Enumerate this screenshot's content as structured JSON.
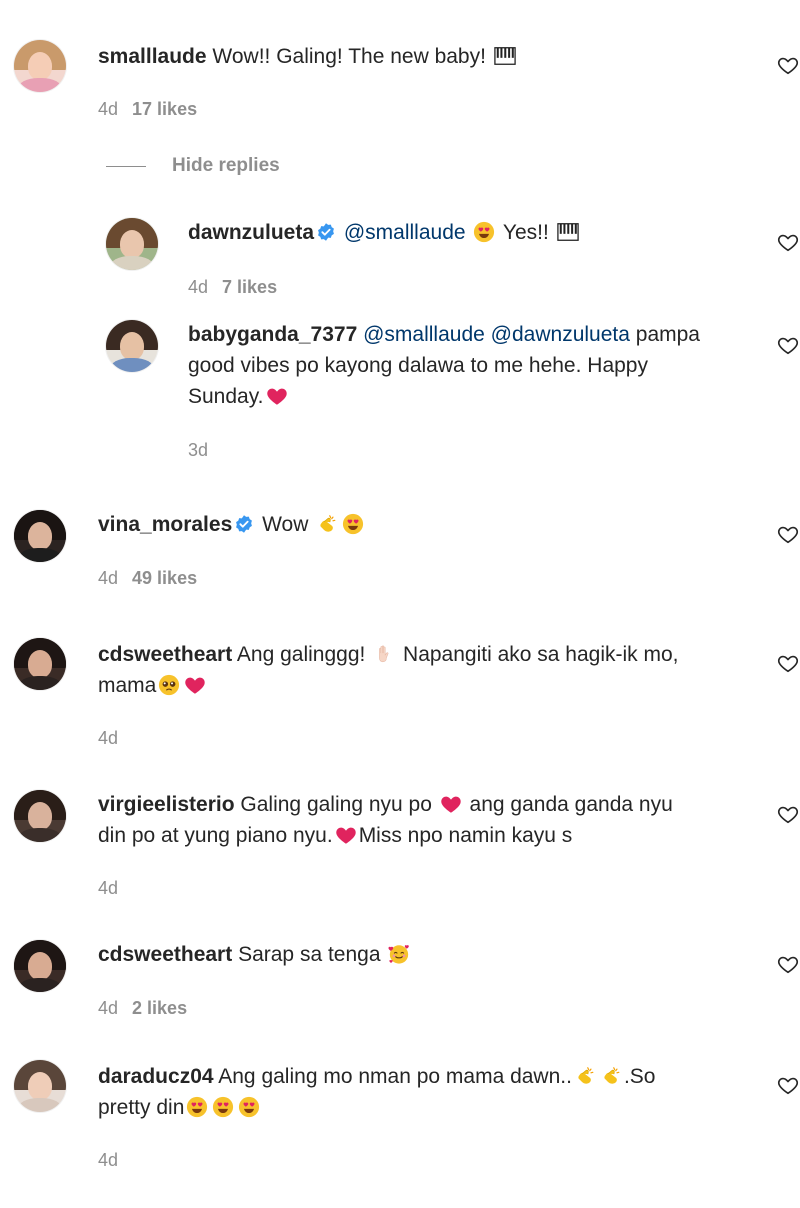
{
  "comments": [
    {
      "id": "c1",
      "username": "smalllaude",
      "verified": false,
      "text_parts": [
        "Wow!! Galing! The new baby! "
      ],
      "emojis_after": [
        "piano"
      ],
      "time": "4d",
      "likes": "17 likes"
    },
    {
      "id": "r1",
      "username": "dawnzulueta",
      "verified": true,
      "mention": "@smalllaude",
      "text_parts": [
        "Yes!! "
      ],
      "emojis_before": [
        "heart-eyes"
      ],
      "emojis_after": [
        "piano"
      ],
      "time": "4d",
      "likes": "7 likes"
    },
    {
      "id": "r2",
      "username": "babyganda_7377",
      "verified": false,
      "mentions": [
        "@smalllaude",
        "@dawnzulueta"
      ],
      "line1_rest": "pampa",
      "line2": "good vibes po kayong dalawa to me hehe. Happy",
      "line3": "Sunday.",
      "emojis_after": [
        "red-heart"
      ],
      "time": "3d",
      "likes": ""
    },
    {
      "id": "c2",
      "username": "vina_morales",
      "verified": true,
      "text_parts": [
        "Wow "
      ],
      "emojis_after": [
        "clapping",
        "heart-eyes"
      ],
      "time": "4d",
      "likes": "49 likes"
    },
    {
      "id": "c3",
      "username": "cdsweetheart",
      "verified": false,
      "line1": "Ang galinggg! ",
      "line1b": " Napangiti ako sa hagik-ik mo,",
      "line2": "mama",
      "time": "4d",
      "likes": ""
    },
    {
      "id": "c4",
      "username": "virgieelisterio",
      "verified": false,
      "line1": "Galing galing nyu po ",
      "line1b": " ang ganda ganda nyu",
      "line2": "din po at yung piano nyu.",
      "line2b": "Miss npo namin kayu s",
      "time": "4d",
      "likes": ""
    },
    {
      "id": "c5",
      "username": "cdsweetheart",
      "verified": false,
      "text_parts": [
        "Sarap sa tenga "
      ],
      "emojis_after": [
        "smiling-hearts"
      ],
      "time": "4d",
      "likes": "2 likes"
    },
    {
      "id": "c6",
      "username": "daraducz04",
      "verified": false,
      "line1": "Ang galing mo nman po mama dawn..",
      "line1b": ".So",
      "line2": "pretty din",
      "time": "4d",
      "likes": ""
    }
  ],
  "replies_toggle": {
    "label": "Hide replies"
  },
  "icons": {
    "like": "heart-outline-icon",
    "verified": "verified-badge-icon"
  },
  "colors": {
    "username": "#262626",
    "mention": "#00376b",
    "meta": "#8e8e8e",
    "verified": "#3897f0",
    "heart": "#ed4956"
  }
}
